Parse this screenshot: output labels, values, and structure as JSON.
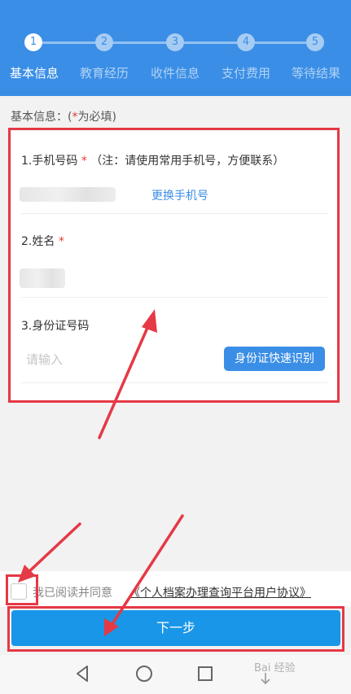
{
  "steps": [
    {
      "num": "1",
      "label": "基本信息"
    },
    {
      "num": "2",
      "label": "教育经历"
    },
    {
      "num": "3",
      "label": "收件信息"
    },
    {
      "num": "4",
      "label": "支付费用"
    },
    {
      "num": "5",
      "label": "等待结果"
    }
  ],
  "section": {
    "title_pre": "基本信息：(",
    "star": "*",
    "title_post": "为必填)"
  },
  "form": {
    "phone_label": "1.手机号码",
    "phone_note": "（注：请使用常用手机号，方便联系）",
    "change_phone": "更换手机号",
    "name_label": "2.姓名",
    "required_star": "*",
    "id_label": "3.身份证号码",
    "id_placeholder": "请输入",
    "id_ocr_button": "身份证快速识别"
  },
  "agreement": {
    "text": "我已阅读并同意",
    "link": "《个人档案办理查询平台用户协议》"
  },
  "next_button": "下一步",
  "watermark": "Bai 经验",
  "colors": {
    "primary": "#3a8ee6",
    "annotation": "#e53945"
  }
}
